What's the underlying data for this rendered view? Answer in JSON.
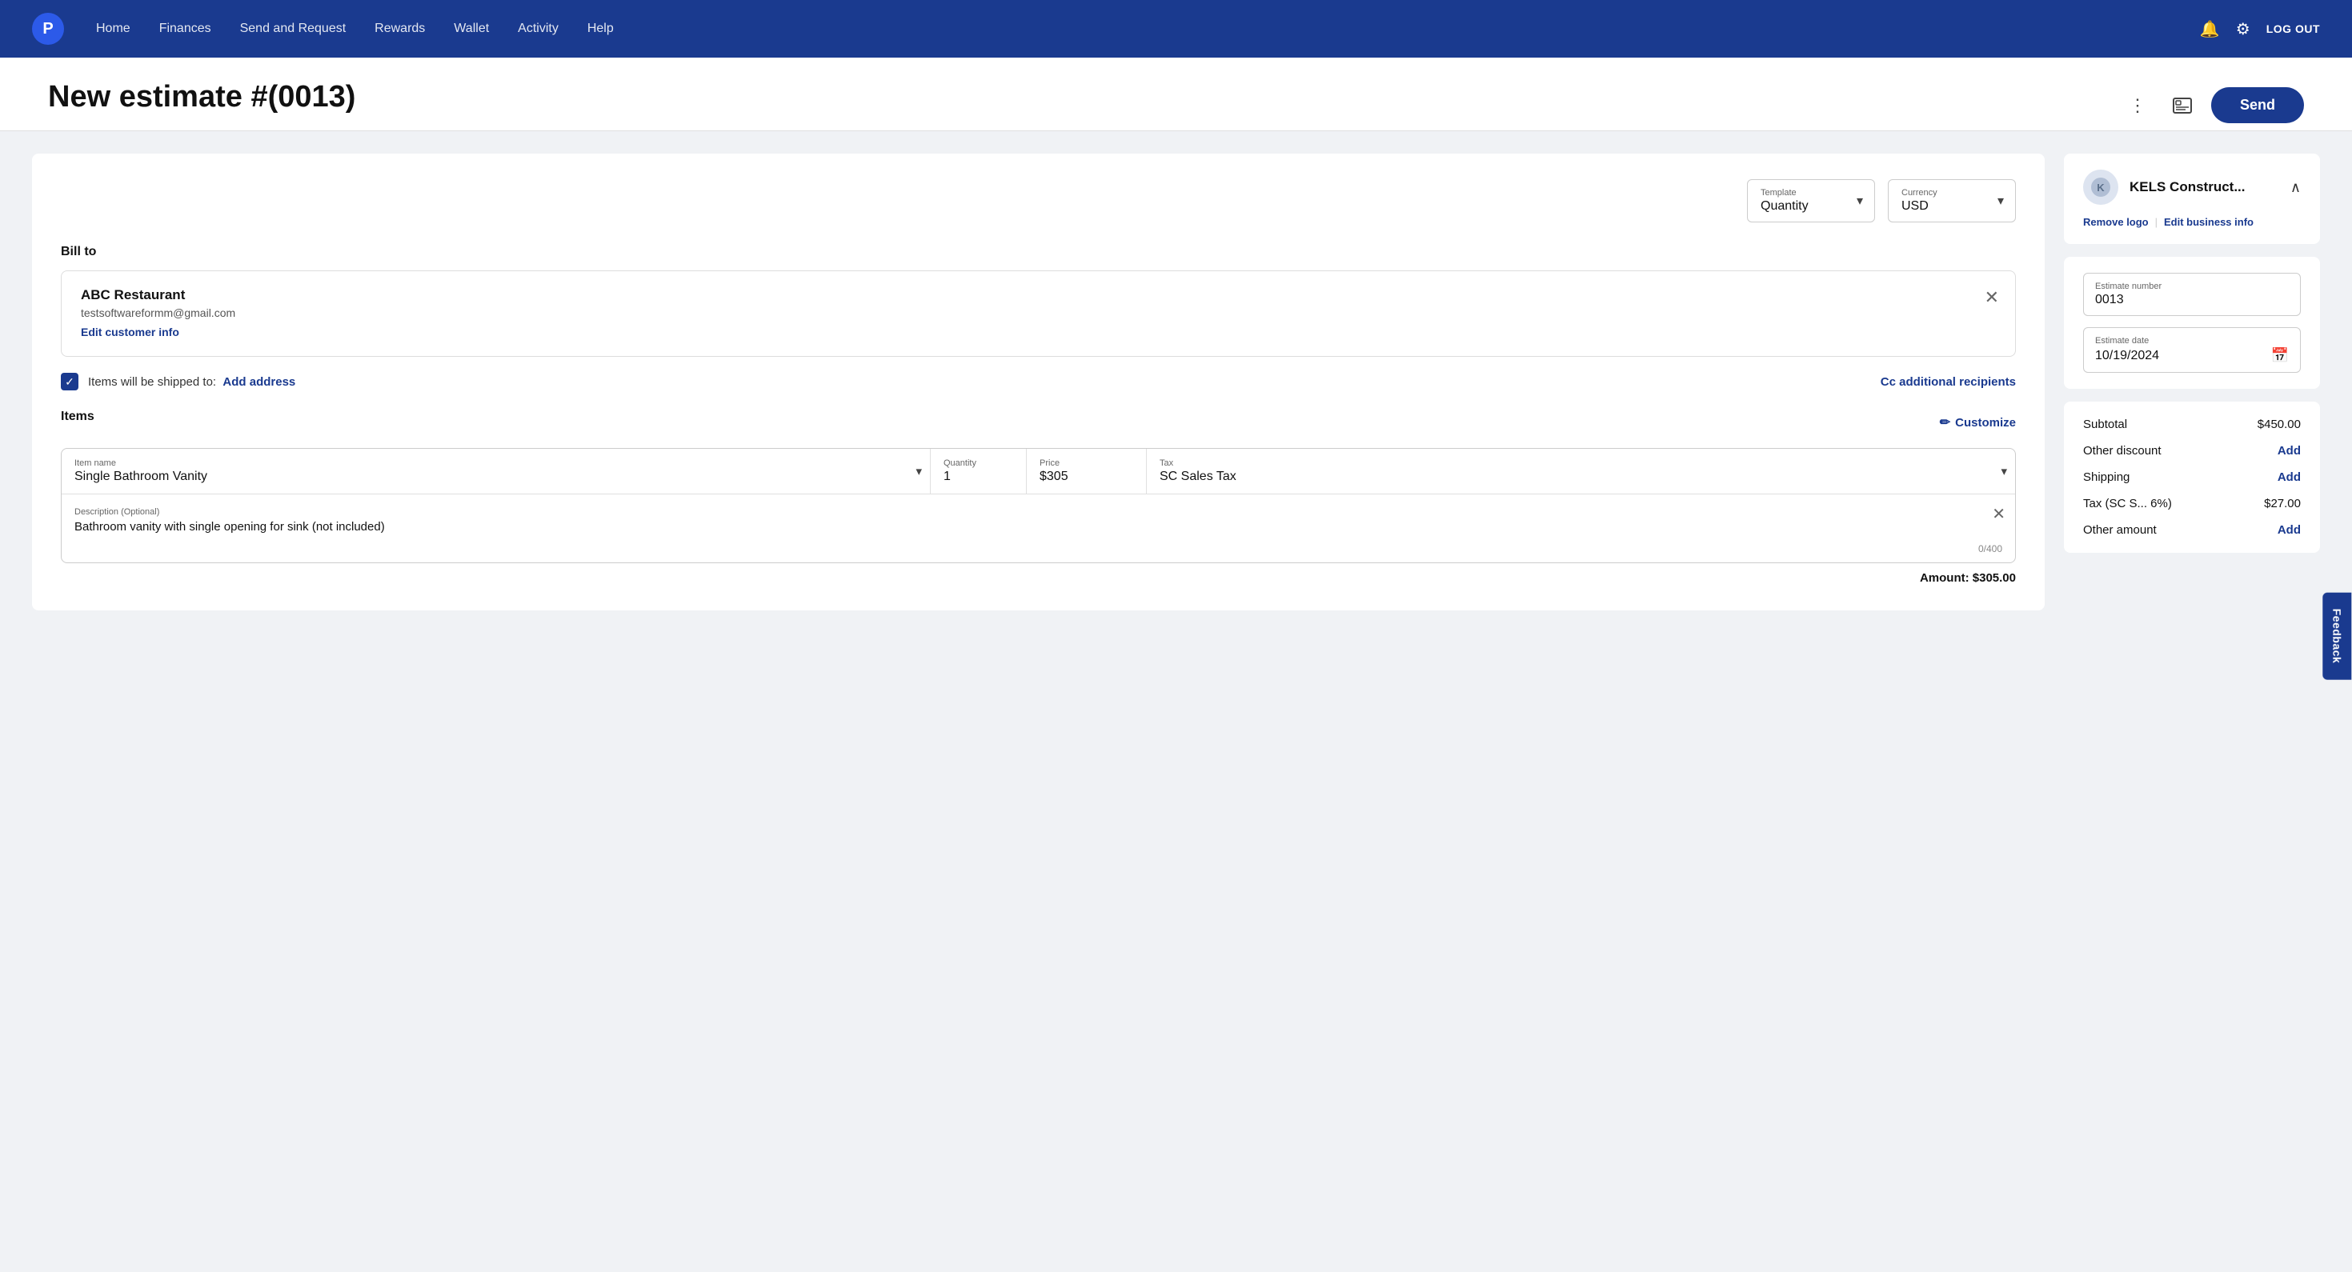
{
  "navbar": {
    "logo_text": "P",
    "links": [
      {
        "label": "Home",
        "id": "home"
      },
      {
        "label": "Finances",
        "id": "finances"
      },
      {
        "label": "Send and Request",
        "id": "send-request"
      },
      {
        "label": "Rewards",
        "id": "rewards"
      },
      {
        "label": "Wallet",
        "id": "wallet"
      },
      {
        "label": "Activity",
        "id": "activity"
      },
      {
        "label": "Help",
        "id": "help"
      }
    ],
    "logout_label": "LOG OUT"
  },
  "page": {
    "title": "New estimate #(0013)",
    "send_button": "Send"
  },
  "form": {
    "template": {
      "label": "Template",
      "value": "Quantity"
    },
    "currency": {
      "label": "Currency",
      "value": "USD"
    },
    "bill_to_label": "Bill to",
    "customer": {
      "name": "ABC Restaurant",
      "email": "testsoftwareformm@gmail.com",
      "edit_link": "Edit customer info"
    },
    "ship": {
      "text": "Items will be shipped to:",
      "add_address": "Add address",
      "cc_label": "Cc additional recipients"
    },
    "items_label": "Items",
    "customize_label": "Customize",
    "item": {
      "name_label": "Item name",
      "name_value": "Single Bathroom Vanity",
      "qty_label": "Quantity",
      "qty_value": "1",
      "price_label": "Price",
      "price_value": "$305",
      "tax_label": "Tax",
      "tax_value": "SC Sales Tax"
    },
    "description": {
      "label": "Description (Optional)",
      "value": "Bathroom vanity with single opening for sink (not included)",
      "char_count": "0/400"
    },
    "amount_label": "Amount: $305.00"
  },
  "sidebar": {
    "business": {
      "name": "KELS Construct...",
      "remove_logo": "Remove logo",
      "edit_info": "Edit business info",
      "divider": "|"
    },
    "estimate_number": {
      "label": "Estimate number",
      "value": "0013"
    },
    "estimate_date": {
      "label": "Estimate date",
      "value": "10/19/2024"
    },
    "summary": {
      "subtotal_label": "Subtotal",
      "subtotal_value": "$450.00",
      "discount_label": "Other discount",
      "discount_action": "Add",
      "shipping_label": "Shipping",
      "shipping_action": "Add",
      "tax_label": "Tax (SC S... 6%)",
      "tax_value": "$27.00",
      "other_amount_label": "Other amount",
      "other_amount_action": "Add"
    }
  },
  "feedback": {
    "label": "Feedback"
  }
}
